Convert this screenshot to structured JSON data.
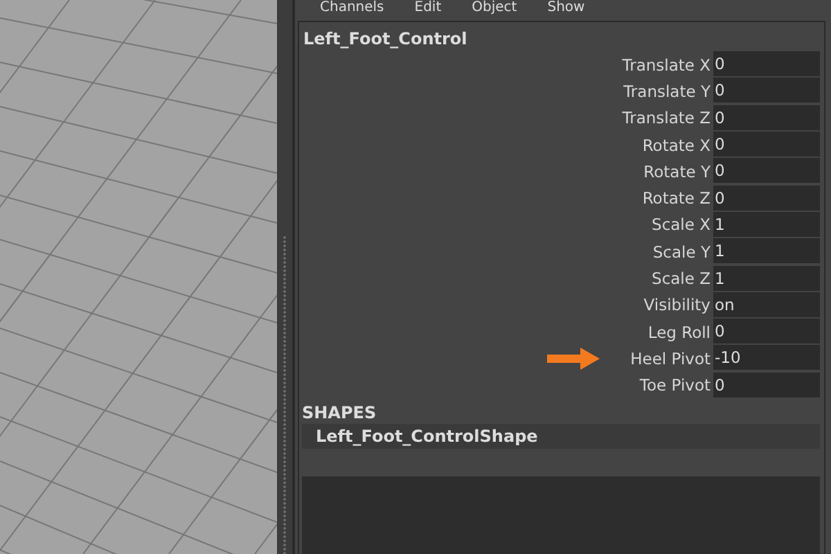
{
  "menu": [
    "Channels",
    "Edit",
    "Object",
    "Show"
  ],
  "node": {
    "title": "Left_Foot_Control",
    "attributes": [
      {
        "label": "Translate X",
        "value": "0",
        "highlighted": false
      },
      {
        "label": "Translate Y",
        "value": "0",
        "highlighted": false
      },
      {
        "label": "Translate Z",
        "value": "0",
        "highlighted": false
      },
      {
        "label": "Rotate X",
        "value": "0",
        "highlighted": false
      },
      {
        "label": "Rotate Y",
        "value": "0",
        "highlighted": false
      },
      {
        "label": "Rotate Z",
        "value": "0",
        "highlighted": false
      },
      {
        "label": "Scale X",
        "value": "1",
        "highlighted": false
      },
      {
        "label": "Scale Y",
        "value": "1",
        "highlighted": false
      },
      {
        "label": "Scale Z",
        "value": "1",
        "highlighted": false
      },
      {
        "label": "Visibility",
        "value": "on",
        "highlighted": false
      },
      {
        "label": "Leg Roll",
        "value": "0",
        "highlighted": false
      },
      {
        "label": "Heel Pivot",
        "value": "-10",
        "highlighted": true
      },
      {
        "label": "Toe Pivot",
        "value": "0",
        "highlighted": false
      }
    ]
  },
  "shapes": {
    "heading": "SHAPES",
    "items": [
      "Left_Foot_ControlShape"
    ]
  }
}
